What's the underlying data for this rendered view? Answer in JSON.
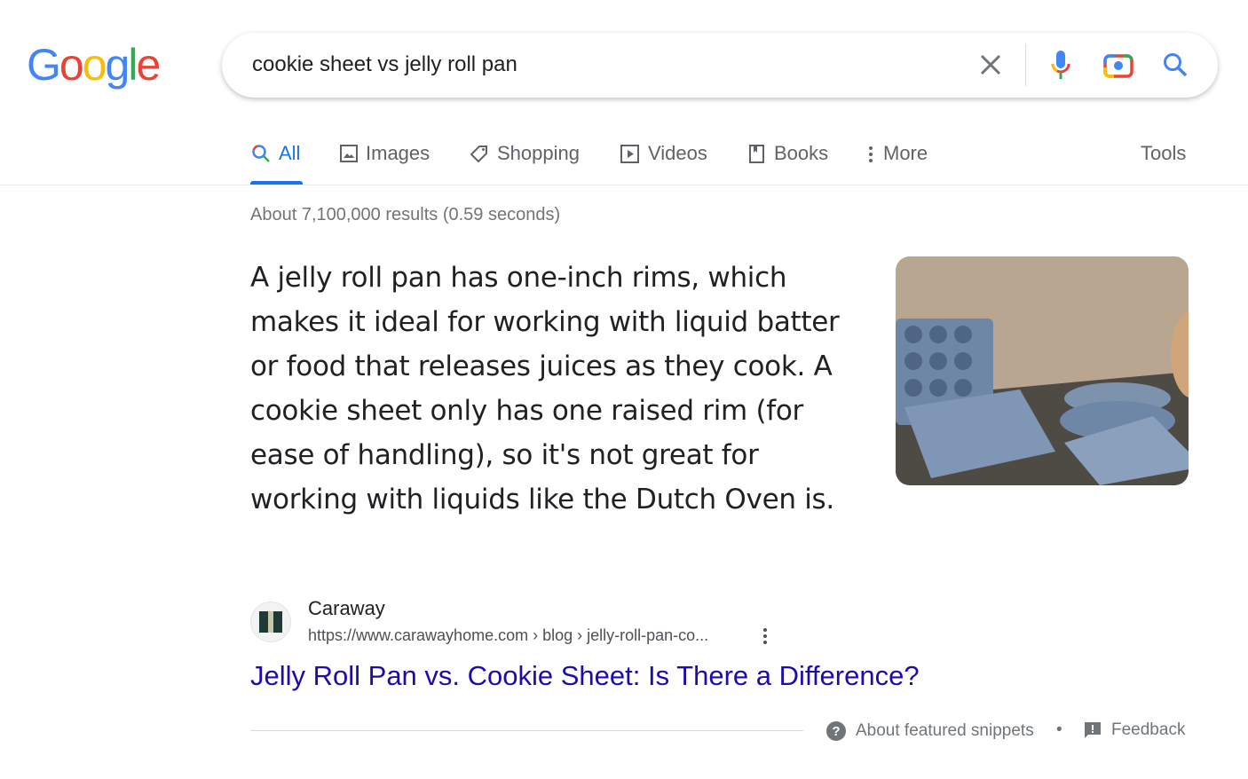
{
  "logo": {
    "letters": [
      "G",
      "o",
      "o",
      "g",
      "l",
      "e"
    ],
    "colors": [
      "#4285f4",
      "#ea4335",
      "#fbbc05",
      "#4285f4",
      "#34a853",
      "#ea4335"
    ]
  },
  "search": {
    "query": "cookie sheet vs jelly roll pan",
    "icons": [
      "close-icon",
      "mic-icon",
      "camera-icon",
      "search-icon"
    ]
  },
  "tabs": [
    {
      "label": "All",
      "icon": "search-icon"
    },
    {
      "label": "Images",
      "icon": "image-icon"
    },
    {
      "label": "Shopping",
      "icon": "tag-icon"
    },
    {
      "label": "Videos",
      "icon": "play-icon"
    },
    {
      "label": "Books",
      "icon": "book-icon"
    },
    {
      "label": "More",
      "icon": "kebab-icon"
    }
  ],
  "tools_label": "Tools",
  "stats": "About 7,100,000 results (0.59 seconds)",
  "snippet": "A jelly roll pan has one-inch rims, which makes it ideal for working with liquid batter or food that releases juices as they cook. A cookie sheet only has one raised rim (for ease of handling), so it's not great for working with liquids like the Dutch Oven is.",
  "source": {
    "site": "Caraway",
    "url": "https://www.carawayhome.com › blog › jelly-roll-pan-co...",
    "title": "Jelly Roll Pan vs. Cookie Sheet: Is There a Difference?"
  },
  "footer": {
    "about": "About featured snippets",
    "separator": "•",
    "feedback": "Feedback"
  },
  "colors": {
    "accent": "#1a73e8",
    "link": "#1a0dab"
  }
}
